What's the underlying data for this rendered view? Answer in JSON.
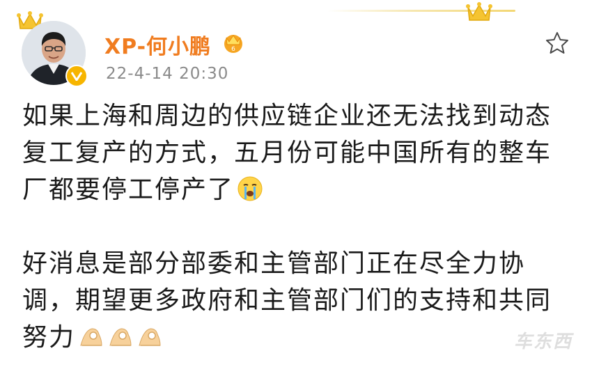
{
  "post": {
    "username": "XP-何小鹏",
    "timestamp": "22-4-14 20:30",
    "paragraphs": [
      {
        "lines": [
          "如果上海和周边的供应链企业还无法找到动态",
          "复工复产的方式，五月份可能中国所有的整车",
          "厂都要停工停产了"
        ]
      },
      {
        "lines": [
          "好消息是部分部委和主管部门正在尽全力协",
          "调，期望更多政府和主管部门们的支持和共同",
          "努力"
        ]
      }
    ]
  },
  "icons": {
    "crying_emoji": "crying-face-emoji",
    "pray_emoji": "ok-hand-emoji",
    "favorite": "star-outline-icon",
    "verified": "verified-v-badge",
    "vip": "crown-vip-badge"
  },
  "colors": {
    "username": "#f07c1f",
    "timestamp": "#8a8a8a",
    "verified": "#f7b500",
    "text": "#1a1a1a"
  },
  "watermark": "车东西"
}
